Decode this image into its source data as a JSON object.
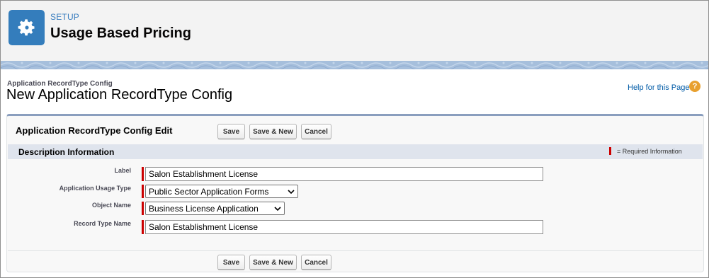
{
  "header": {
    "icon": "gear-icon",
    "setup_label": "SETUP",
    "title": "Usage Based Pricing",
    "brand_color": "#347dbc"
  },
  "page": {
    "breadcrumb": "Application RecordType Config",
    "title": "New Application RecordType Config",
    "help_link": "Help for this Page",
    "help_icon": "help-question-icon"
  },
  "edit_block": {
    "title": "Application RecordType Config Edit",
    "buttons": {
      "save": "Save",
      "save_new": "Save & New",
      "cancel": "Cancel"
    }
  },
  "section": {
    "title": "Description Information",
    "required_legend": "= Required Information"
  },
  "fields": {
    "label": {
      "label": "Label",
      "value": "Salon Establishment License"
    },
    "usage_type": {
      "label": "Application Usage Type",
      "value": "Public Sector Application Forms"
    },
    "object_name": {
      "label": "Object Name",
      "value": "Business License Application"
    },
    "record_type_name": {
      "label": "Record Type Name",
      "value": "Salon Establishment License"
    }
  },
  "colors": {
    "required": "#cc0000",
    "section_bg": "#dfe4ed",
    "link": "#015ba7"
  }
}
